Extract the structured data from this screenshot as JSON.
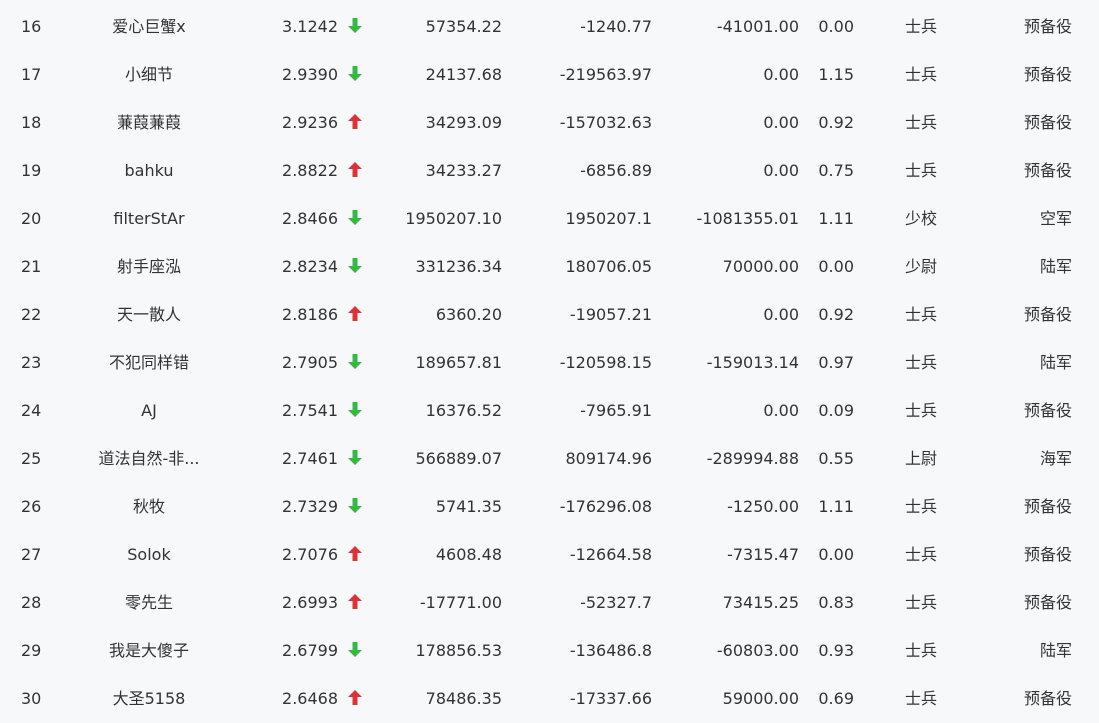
{
  "colors": {
    "down": "#3bb54a",
    "up": "#d9343a",
    "text": "#333333",
    "background": "#f7f8fa"
  },
  "rows": [
    {
      "rank": "16",
      "name": "爱心巨蟹x",
      "score": "3.1242",
      "trend": "down",
      "v1": "57354.22",
      "v2": "-1240.77",
      "v3": "-41001.00",
      "ratio": "0.00",
      "rank_title": "士兵",
      "branch": "预备役"
    },
    {
      "rank": "17",
      "name": "小细节",
      "score": "2.9390",
      "trend": "down",
      "v1": "24137.68",
      "v2": "-219563.97",
      "v3": "0.00",
      "ratio": "1.15",
      "rank_title": "士兵",
      "branch": "预备役"
    },
    {
      "rank": "18",
      "name": "蒹葭蒹葭",
      "score": "2.9236",
      "trend": "up",
      "v1": "34293.09",
      "v2": "-157032.63",
      "v3": "0.00",
      "ratio": "0.92",
      "rank_title": "士兵",
      "branch": "预备役"
    },
    {
      "rank": "19",
      "name": "bahku",
      "score": "2.8822",
      "trend": "up",
      "v1": "34233.27",
      "v2": "-6856.89",
      "v3": "0.00",
      "ratio": "0.75",
      "rank_title": "士兵",
      "branch": "预备役"
    },
    {
      "rank": "20",
      "name": "filterStAr",
      "score": "2.8466",
      "trend": "down",
      "v1": "1950207.10",
      "v2": "1950207.1",
      "v3": "-1081355.01",
      "ratio": "1.11",
      "rank_title": "少校",
      "branch": "空军"
    },
    {
      "rank": "21",
      "name": "射手座泓",
      "score": "2.8234",
      "trend": "down",
      "v1": "331236.34",
      "v2": "180706.05",
      "v3": "70000.00",
      "ratio": "0.00",
      "rank_title": "少尉",
      "branch": "陆军"
    },
    {
      "rank": "22",
      "name": "天一散人",
      "score": "2.8186",
      "trend": "up",
      "v1": "6360.20",
      "v2": "-19057.21",
      "v3": "0.00",
      "ratio": "0.92",
      "rank_title": "士兵",
      "branch": "预备役"
    },
    {
      "rank": "23",
      "name": "不犯同样错",
      "score": "2.7905",
      "trend": "down",
      "v1": "189657.81",
      "v2": "-120598.15",
      "v3": "-159013.14",
      "ratio": "0.97",
      "rank_title": "士兵",
      "branch": "陆军"
    },
    {
      "rank": "24",
      "name": "AJ",
      "score": "2.7541",
      "trend": "down",
      "v1": "16376.52",
      "v2": "-7965.91",
      "v3": "0.00",
      "ratio": "0.09",
      "rank_title": "士兵",
      "branch": "预备役"
    },
    {
      "rank": "25",
      "name": "道法自然-非...",
      "score": "2.7461",
      "trend": "down",
      "v1": "566889.07",
      "v2": "809174.96",
      "v3": "-289994.88",
      "ratio": "0.55",
      "rank_title": "上尉",
      "branch": "海军"
    },
    {
      "rank": "26",
      "name": "秋牧",
      "score": "2.7329",
      "trend": "down",
      "v1": "5741.35",
      "v2": "-176296.08",
      "v3": "-1250.00",
      "ratio": "1.11",
      "rank_title": "士兵",
      "branch": "预备役"
    },
    {
      "rank": "27",
      "name": "Solok",
      "score": "2.7076",
      "trend": "up",
      "v1": "4608.48",
      "v2": "-12664.58",
      "v3": "-7315.47",
      "ratio": "0.00",
      "rank_title": "士兵",
      "branch": "预备役"
    },
    {
      "rank": "28",
      "name": "零先生",
      "score": "2.6993",
      "trend": "up",
      "v1": "-17771.00",
      "v2": "-52327.7",
      "v3": "73415.25",
      "ratio": "0.83",
      "rank_title": "士兵",
      "branch": "预备役"
    },
    {
      "rank": "29",
      "name": "我是大傻子",
      "score": "2.6799",
      "trend": "down",
      "v1": "178856.53",
      "v2": "-136486.8",
      "v3": "-60803.00",
      "ratio": "0.93",
      "rank_title": "士兵",
      "branch": "陆军"
    },
    {
      "rank": "30",
      "name": "大圣5158",
      "score": "2.6468",
      "trend": "up",
      "v1": "78486.35",
      "v2": "-17337.66",
      "v3": "59000.00",
      "ratio": "0.69",
      "rank_title": "士兵",
      "branch": "预备役"
    }
  ]
}
